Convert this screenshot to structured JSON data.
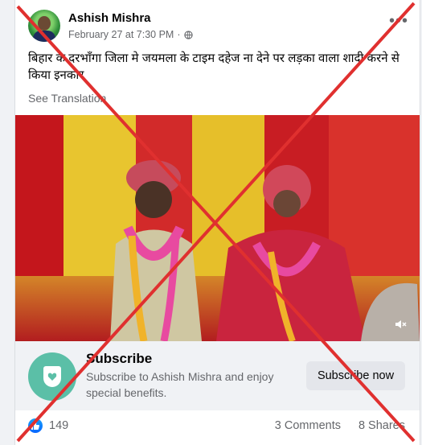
{
  "post": {
    "author": "Ashish Mishra",
    "timestamp": "February 27 at 7:30 PM",
    "privacy_separator": "·",
    "more_label": "•••",
    "text": "बिहार के दरभाँगा जिला मे जयमला के टाइम दहेज ना देने पर लड़का वाला शादी करने से किया इनकार",
    "see_translation": "See Translation"
  },
  "subscribe": {
    "title": "Subscribe",
    "description": "Subscribe to Ashish Mishra and enjoy special benefits.",
    "button_label": "Subscribe now"
  },
  "reactions": {
    "like_count": "149",
    "comments": "3 Comments",
    "shares": "8 Shares"
  },
  "icons": {
    "privacy": "globe-icon",
    "video": "mute-icon",
    "reaction": "like-icon",
    "subscribe": "heart-badge-icon"
  },
  "colors": {
    "cross_red": "#e0302f",
    "subscribe_icon_bg": "#5bbfa7",
    "like_blue": "#0866ff"
  }
}
